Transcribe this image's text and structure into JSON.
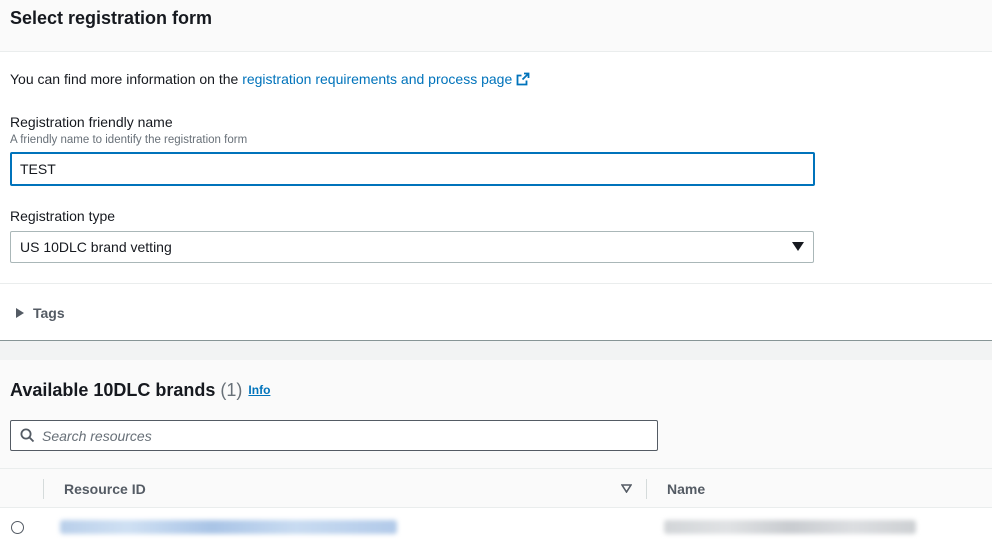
{
  "panel": {
    "title": "Select registration form"
  },
  "info": {
    "prefix": "You can find more information on the ",
    "link_text": "registration requirements and process page"
  },
  "friendly_name": {
    "label": "Registration friendly name",
    "description": "A friendly name to identify the registration form",
    "value": "TEST"
  },
  "registration_type": {
    "label": "Registration type",
    "selected": "US 10DLC brand vetting"
  },
  "tags": {
    "label": "Tags"
  },
  "brands": {
    "title": "Available 10DLC brands",
    "count": "(1)",
    "info_link": "Info",
    "search_placeholder": "Search resources",
    "columns": [
      "Resource ID",
      "Name"
    ]
  },
  "colors": {
    "link": "#0073bb",
    "focus_border": "#0073bb",
    "header_bg": "#fafafa",
    "text": "#16191f",
    "muted": "#687078"
  },
  "icons": {
    "external_link": "external-link-icon",
    "caret": "caret-down-icon",
    "expand": "caret-right-icon",
    "search": "search-icon",
    "sort": "sort-descending-icon"
  }
}
